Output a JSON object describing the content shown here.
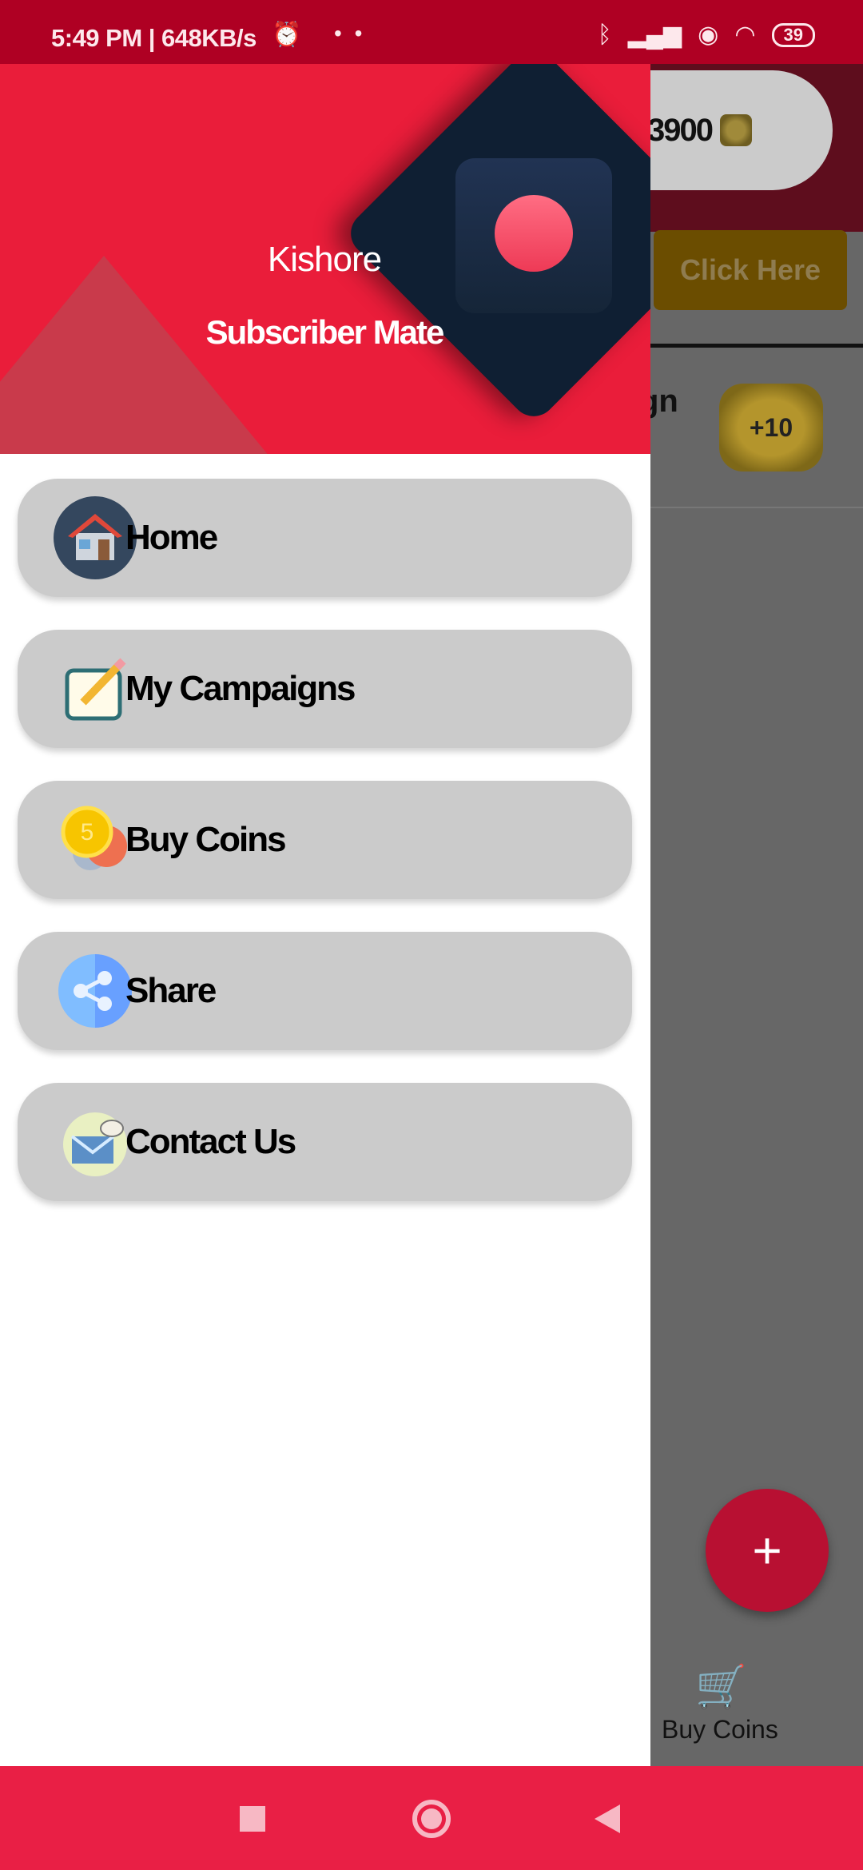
{
  "status_bar": {
    "time": "5:49 PM | 648KB/s",
    "dots": "• •",
    "battery": "39",
    "icons": [
      "alarm-icon",
      "bluetooth-icon",
      "signal-icon",
      "hotspot-icon",
      "wifi-icon",
      "battery-icon"
    ]
  },
  "background": {
    "coins": "3900",
    "click_button": "Click Here",
    "campaign_text": "gn",
    "coin_bonus": "+10",
    "fab_label": "+",
    "bottom_nav_label": "Buy Coins"
  },
  "drawer": {
    "user_name": "Kishore",
    "app_name": "Subscriber Mate",
    "items": [
      {
        "label": "Home",
        "icon": "house-icon"
      },
      {
        "label": "My Campaigns",
        "icon": "pencil-note-icon"
      },
      {
        "label": "Buy Coins",
        "icon": "coins-icon"
      },
      {
        "label": "Share",
        "icon": "share-icon"
      },
      {
        "label": "Contact Us",
        "icon": "envelope-icon"
      }
    ]
  },
  "colors": {
    "status_bar": "#af0023",
    "header": "#ea1d3a",
    "fab": "#b81032",
    "nav_bar": "#e91f45"
  }
}
